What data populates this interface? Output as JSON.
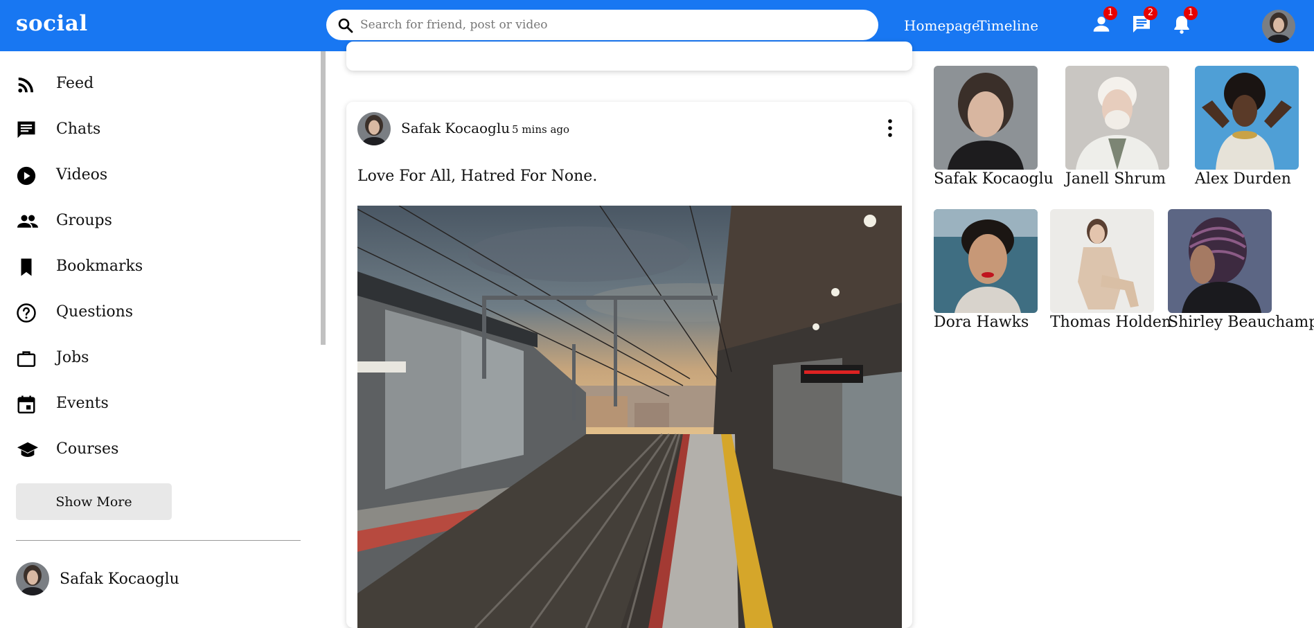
{
  "topbar": {
    "logo": "social",
    "search_placeholder": "Search for friend, post or video",
    "links": [
      "Homepage",
      "Timeline"
    ],
    "badges": {
      "friends": "1",
      "messages": "2",
      "notifications": "1"
    }
  },
  "sidebar": {
    "items": [
      {
        "label": "Feed",
        "icon": "rss-feed-icon"
      },
      {
        "label": "Chats",
        "icon": "chat-icon"
      },
      {
        "label": "Videos",
        "icon": "play-circle-icon"
      },
      {
        "label": "Groups",
        "icon": "group-icon"
      },
      {
        "label": "Bookmarks",
        "icon": "bookmark-icon"
      },
      {
        "label": "Questions",
        "icon": "help-circle-icon"
      },
      {
        "label": "Jobs",
        "icon": "briefcase-icon"
      },
      {
        "label": "Events",
        "icon": "calendar-icon"
      },
      {
        "label": "Courses",
        "icon": "school-icon"
      }
    ],
    "show_more": "Show More",
    "friend": "Safak Kocaoglu"
  },
  "post": {
    "username": "Safak Kocaoglu",
    "time": "5 mins ago",
    "text": "Love For All, Hatred For None."
  },
  "online_friends": [
    "Safak Kocaoglu",
    "Janell Shrum",
    "Alex Durden",
    "Dora Hawks",
    "Thomas Holden",
    "Shirley Beauchamp"
  ],
  "colors": {
    "brand": "#1877f2",
    "badge": "#e60000"
  }
}
